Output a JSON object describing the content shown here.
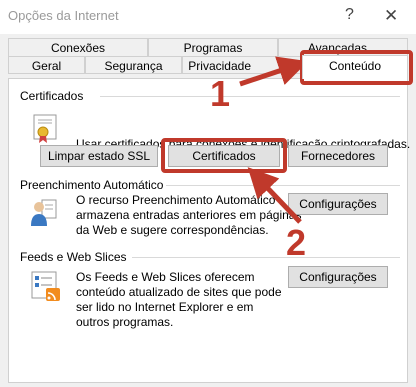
{
  "window": {
    "title": "Opções da Internet",
    "help_glyph": "?",
    "close_glyph": "✕"
  },
  "tabs": {
    "back_row": [
      "Conexões",
      "Programas",
      "Avançadas"
    ],
    "front_row": [
      "Geral",
      "Segurança",
      "Privacidade",
      "Conteúdo"
    ],
    "active": "Conteúdo"
  },
  "certificados": {
    "title": "Certificados",
    "description": "Usar certificados para conexões e identificação criptografadas.",
    "buttons": {
      "clear_ssl": "Limpar estado SSL",
      "certificates": "Certificados",
      "publishers": "Fornecedores"
    }
  },
  "autocomplete": {
    "title": "Preenchimento Automático",
    "description_lines": [
      "O recurso Preenchimento Automático",
      "armazena entradas anteriores em páginas",
      "da Web e sugere correspondências."
    ],
    "settings_button": "Configurações"
  },
  "feeds": {
    "title": "Feeds e Web Slices",
    "description_lines": [
      "Os Feeds e Web Slices oferecem",
      "conteúdo atualizado de sites que pode",
      "ser lido no Internet Explorer e em",
      "outros programas."
    ],
    "settings_button": "Configurações"
  },
  "annotations": {
    "step1": "1",
    "step2": "2",
    "color": "#c0392b"
  },
  "icons": {
    "certificate": "certificate-icon",
    "autocomplete": "autocomplete-user-icon",
    "feeds": "feed-list-icon"
  }
}
